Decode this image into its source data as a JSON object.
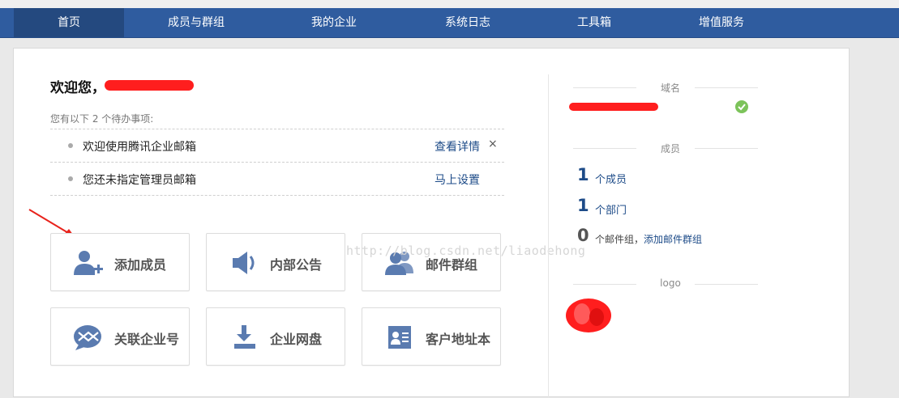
{
  "nav": {
    "items": [
      {
        "label": "首页",
        "active": true
      },
      {
        "label": "成员与群组"
      },
      {
        "label": "我的企业"
      },
      {
        "label": "系统日志"
      },
      {
        "label": "工具箱"
      },
      {
        "label": "增值服务"
      }
    ]
  },
  "welcome": {
    "greeting": "欢迎您，"
  },
  "todo": {
    "hint": "您有以下 2 个待办事项:",
    "items": [
      {
        "text": "欢迎使用腾讯企业邮箱",
        "link": "查看详情",
        "close": "×"
      },
      {
        "text": "您还未指定管理员邮箱",
        "link": "马上设置"
      }
    ]
  },
  "tiles": [
    {
      "label": "添加成员",
      "icon": "add-user-icon"
    },
    {
      "label": "内部公告",
      "icon": "speaker-icon"
    },
    {
      "label": "邮件群组",
      "icon": "group-icon"
    },
    {
      "label": "关联企业号",
      "icon": "link-enterprise-icon"
    },
    {
      "label": "企业网盘",
      "icon": "download-disk-icon"
    },
    {
      "label": "客户地址本",
      "icon": "address-book-icon"
    }
  ],
  "side": {
    "domain_label": "域名",
    "members_label": "成员",
    "logo_label": "logo",
    "member_count": "1",
    "member_unit": "个成员",
    "dept_count": "1",
    "dept_unit": "个部门",
    "group_count": "0",
    "group_unit": "个邮件组，",
    "add_group_link": "添加邮件群组"
  },
  "watermark": "http://blog.csdn.net/liaodehong",
  "colors": {
    "nav_bg": "#2f5c9f",
    "nav_active": "#24497f",
    "link": "#1d4b88",
    "tile_icon": "#5a7bb0",
    "check": "#7cc35a",
    "redaction": "#ff1e1e"
  }
}
